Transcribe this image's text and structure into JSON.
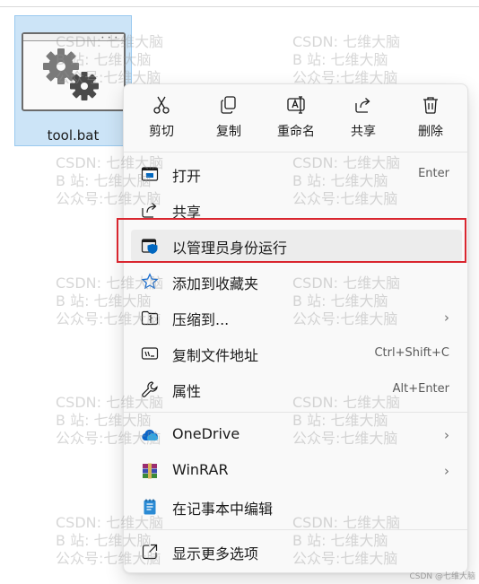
{
  "file": {
    "name": "tool.bat"
  },
  "watermark": {
    "lines": [
      "CSDN: 七维大脑",
      "B 站: 七维大脑",
      "公众号:七维大脑"
    ]
  },
  "menu": {
    "top_actions": [
      {
        "id": "cut",
        "label": "剪切",
        "icon": "scissors-icon"
      },
      {
        "id": "copy",
        "label": "复制",
        "icon": "copy-icon"
      },
      {
        "id": "rename",
        "label": "重命名",
        "icon": "rename-icon"
      },
      {
        "id": "share",
        "label": "共享",
        "icon": "share-icon"
      },
      {
        "id": "delete",
        "label": "删除",
        "icon": "trash-icon"
      }
    ],
    "items": [
      {
        "label": "打开",
        "shortcut": "Enter",
        "icon": "open-icon"
      },
      {
        "label": "共享",
        "shortcut": "",
        "icon": "share-icon"
      },
      {
        "label": "以管理员身份运行",
        "shortcut": "",
        "icon": "admin-shield-icon",
        "highlighted": true
      },
      {
        "label": "添加到收藏夹",
        "shortcut": "",
        "icon": "star-icon"
      },
      {
        "label": "压缩到...",
        "shortcut": "",
        "icon": "zip-folder-icon",
        "submenu": true
      },
      {
        "label": "复制文件地址",
        "shortcut": "Ctrl+Shift+C",
        "icon": "copy-path-icon"
      },
      {
        "label": "属性",
        "shortcut": "Alt+Enter",
        "icon": "wrench-icon"
      },
      {
        "label": "OneDrive",
        "shortcut": "",
        "icon": "onedrive-cloud-icon",
        "submenu": true
      },
      {
        "label": "WinRAR",
        "shortcut": "",
        "icon": "winrar-icon",
        "submenu": true
      },
      {
        "label": "在记事本中编辑",
        "shortcut": "",
        "icon": "notepad-icon"
      },
      {
        "label": "显示更多选项",
        "shortcut": "",
        "icon": "more-options-icon"
      }
    ],
    "chevron": "›"
  },
  "credit": "CSDN @七维大脑",
  "colors": {
    "highlight_box": "#d9262f",
    "selection": "#cce4f7",
    "accent": "#0067c0"
  }
}
